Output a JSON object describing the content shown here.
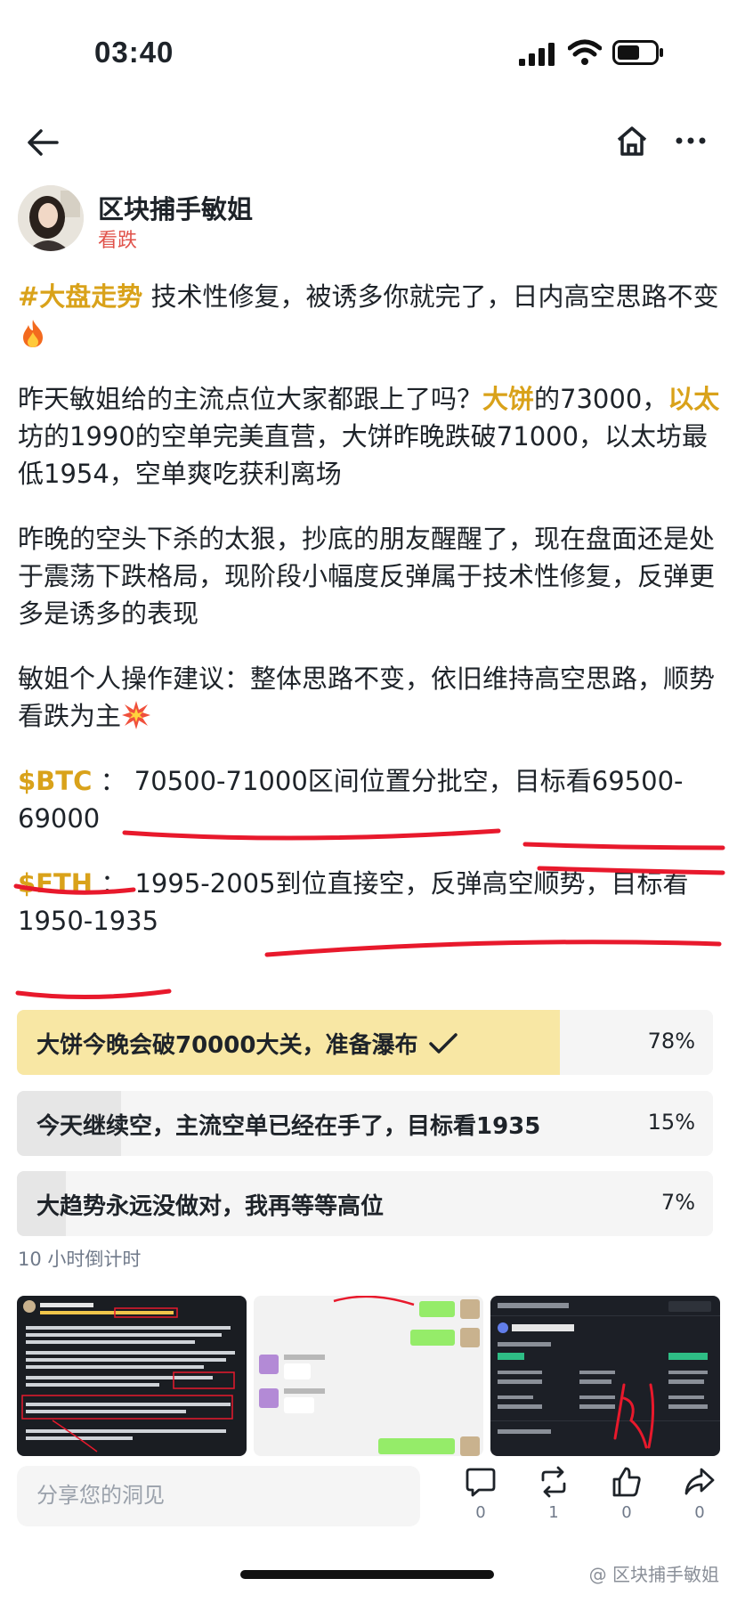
{
  "status": {
    "time": "03:40"
  },
  "author": {
    "name": "区块捕手敏姐",
    "tag": "看跌"
  },
  "post": {
    "hashtag": "#大盘走势",
    "p1_text": " 技术性修复，被诱多你就完了，日内高空思路不变",
    "p2_a": "昨天敏姐给的主流点位大家都跟上了吗？",
    "p2_coin1": "大饼",
    "p2_b": "的73000，",
    "p2_coin2": "以太",
    "p2_c": "坊的1990的空单完美直营，大饼昨晚跌破71000，以太坊最低1954，空单爽吃获利离场",
    "p3": "昨晚的空头下杀的太狠，抄底的朋友醒醒了，现在盘面还是处于震荡下跌格局，现阶段小幅度反弹属于技术性修复，反弹更多是诱多的表现",
    "p4": "敏姐个人操作建议：整体思路不变，依旧维持高空思路，顺势看跌为主",
    "btc_ticker": "$BTC",
    "btc_text": " ： 70500-71000区间位置分批空，目标看69500-69000",
    "eth_ticker": "$ETH",
    "eth_text": " ： 1995-2005到位直接空，反弹高空顺势，目标看1950-1935"
  },
  "poll": {
    "options": [
      {
        "label": "大饼今晚会破70000大关，准备瀑布",
        "percent": "78%",
        "value": 0.78,
        "selected": true
      },
      {
        "label": "今天继续空，主流空单已经在手了，目标看1935",
        "percent": "15%",
        "value": 0.15,
        "selected": false
      },
      {
        "label": "大趋势永远没做对，我再等等高位",
        "percent": "7%",
        "value": 0.07,
        "selected": false
      }
    ],
    "countdown": "10 小时倒计时"
  },
  "bottom": {
    "share_placeholder": "分享您的洞见",
    "comment_count": "0",
    "repost_count": "1",
    "like_count": "0",
    "share_count": "0",
    "watermark": "@ 区块捕手敏姐"
  },
  "colors": {
    "accent": "#d9a21a",
    "tag": "#e0524a",
    "annotation": "#e8192c",
    "poll_selected": "#f8e7a4"
  }
}
